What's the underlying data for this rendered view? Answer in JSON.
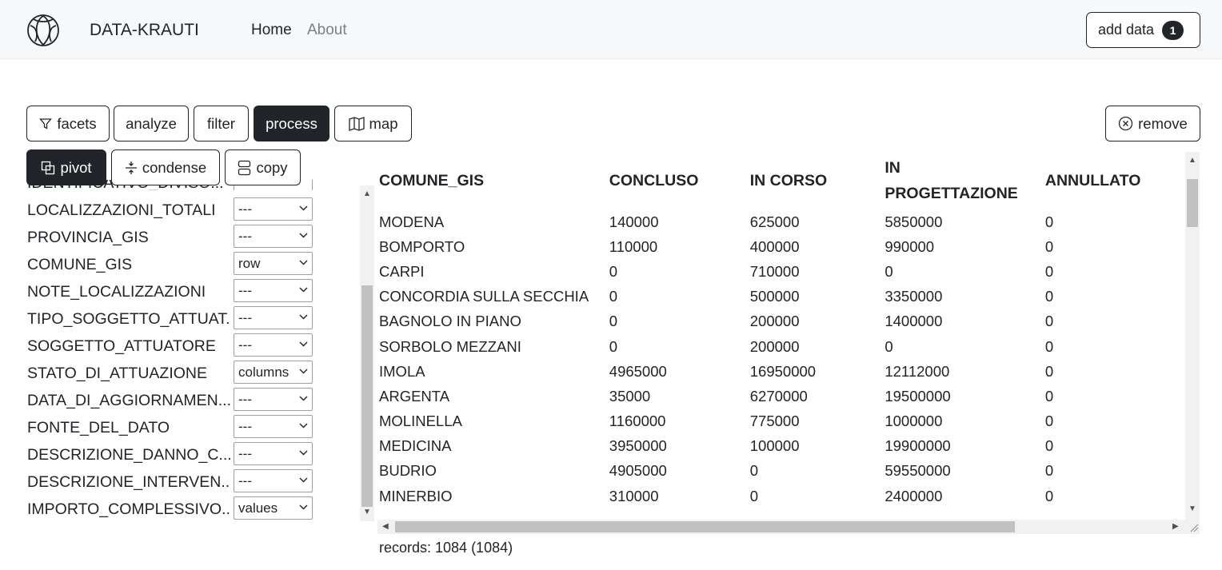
{
  "navbar": {
    "brand": "DATA-KRAUTI",
    "links": [
      "Home",
      "About"
    ],
    "add_data_label": "add data",
    "add_data_count": "1"
  },
  "toolbar": {
    "tabs": [
      "facets",
      "analyze",
      "filter",
      "process",
      "map"
    ],
    "active_tab": "process",
    "remove_label": "remove"
  },
  "process": {
    "actions": [
      "pivot",
      "condense",
      "copy"
    ],
    "active_action": "pivot"
  },
  "fields": [
    {
      "label": "IDENTIFICATIVO_DIVISO...",
      "value": ""
    },
    {
      "label": "LOCALIZZAZIONI_TOTALI",
      "value": "---"
    },
    {
      "label": "PROVINCIA_GIS",
      "value": "---"
    },
    {
      "label": "COMUNE_GIS",
      "value": "row"
    },
    {
      "label": "NOTE_LOCALIZZAZIONI",
      "value": "---"
    },
    {
      "label": "TIPO_SOGGETTO_ATTUAT...",
      "value": "---"
    },
    {
      "label": "SOGGETTO_ATTUATORE",
      "value": "---"
    },
    {
      "label": "STATO_DI_ATTUAZIONE",
      "value": "columns"
    },
    {
      "label": "DATA_DI_AGGIORNAMEN...",
      "value": "---"
    },
    {
      "label": "FONTE_DEL_DATO",
      "value": "---"
    },
    {
      "label": "DESCRIZIONE_DANNO_C...",
      "value": "---"
    },
    {
      "label": "DESCRIZIONE_INTERVEN...",
      "value": "---"
    },
    {
      "label": "IMPORTO_COMPLESSIVO...",
      "value": "values"
    }
  ],
  "table": {
    "columns": [
      "COMUNE_GIS",
      "CONCLUSO",
      "IN CORSO",
      "IN PROGETTAZIONE",
      "ANNULLATO"
    ],
    "rows": [
      [
        "MODENA",
        "140000",
        "625000",
        "5850000",
        "0"
      ],
      [
        "BOMPORTO",
        "110000",
        "400000",
        "990000",
        "0"
      ],
      [
        "CARPI",
        "0",
        "710000",
        "0",
        "0"
      ],
      [
        "CONCORDIA SULLA SECCHIA",
        "0",
        "500000",
        "3350000",
        "0"
      ],
      [
        "BAGNOLO IN PIANO",
        "0",
        "200000",
        "1400000",
        "0"
      ],
      [
        "SORBOLO MEZZANI",
        "0",
        "200000",
        "0",
        "0"
      ],
      [
        "IMOLA",
        "4965000",
        "16950000",
        "12112000",
        "0"
      ],
      [
        "ARGENTA",
        "35000",
        "6270000",
        "19500000",
        "0"
      ],
      [
        "MOLINELLA",
        "1160000",
        "775000",
        "1000000",
        "0"
      ],
      [
        "MEDICINA",
        "3950000",
        "100000",
        "19900000",
        "0"
      ],
      [
        "BUDRIO",
        "4905000",
        "0",
        "59550000",
        "0"
      ],
      [
        "MINERBIO",
        "310000",
        "0",
        "2400000",
        "0"
      ]
    ]
  },
  "records_text": "records: 1084 (1084)"
}
